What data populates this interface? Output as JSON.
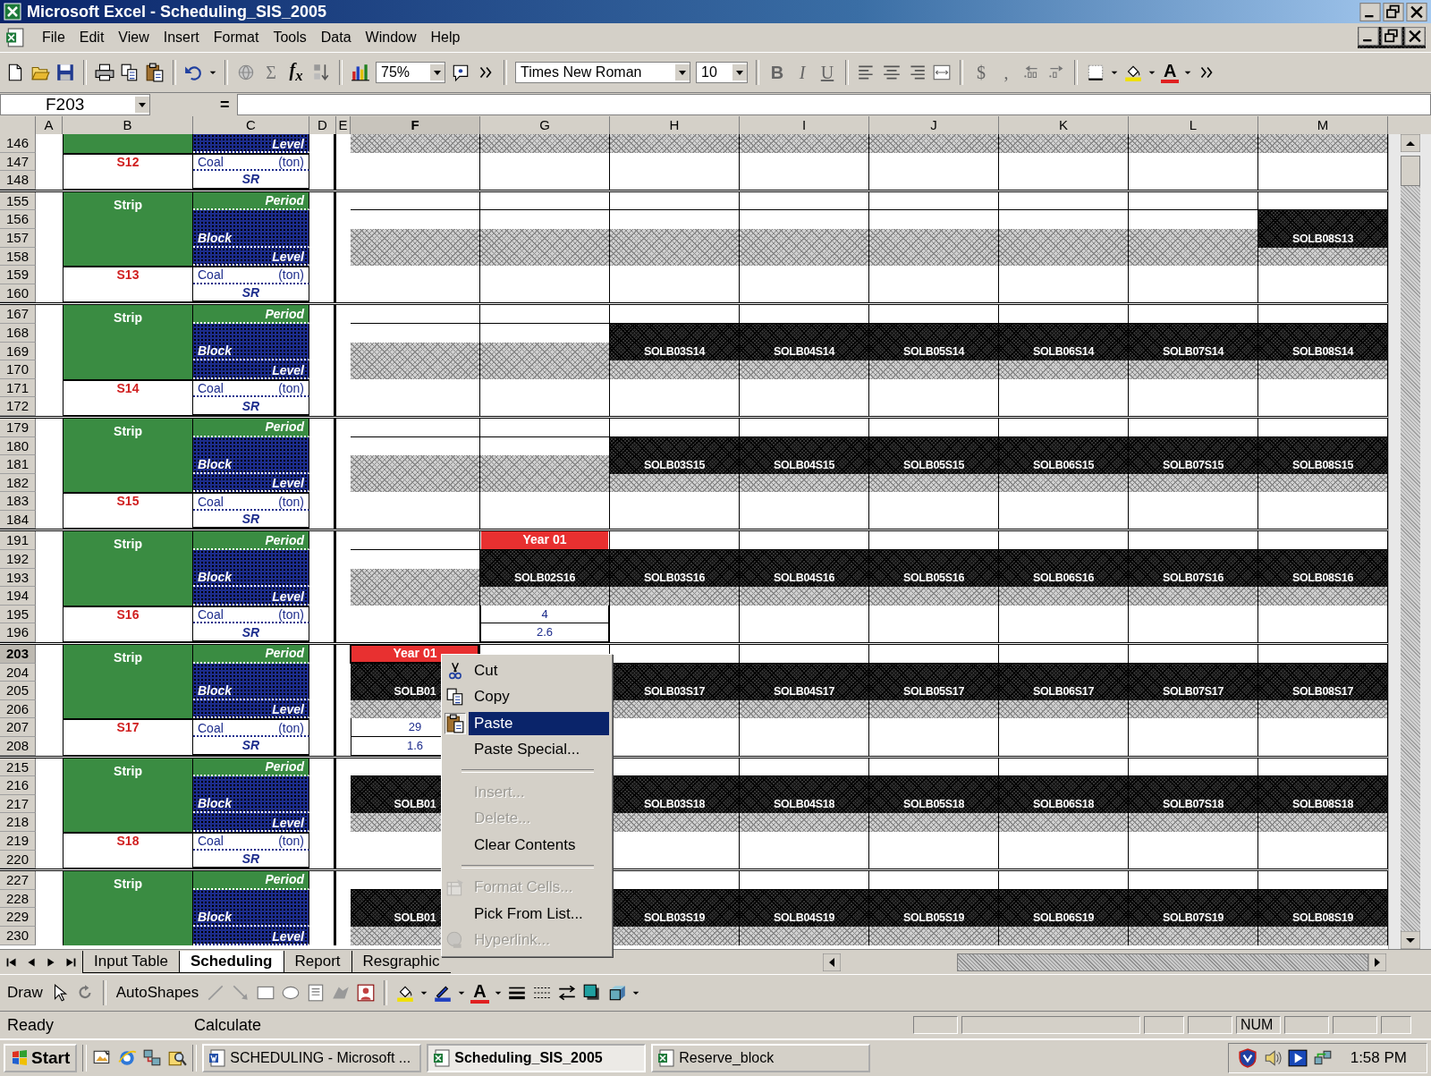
{
  "window": {
    "title": "Microsoft Excel - Scheduling_SIS_2005"
  },
  "menu": [
    "File",
    "Edit",
    "View",
    "Insert",
    "Format",
    "Tools",
    "Data",
    "Window",
    "Help"
  ],
  "toolbar": {
    "sum": "Σ",
    "function": "f$_{x}$",
    "zoom": "75%",
    "font": "Times New Roman",
    "size": "10",
    "bold": "B",
    "italic": "I",
    "underline": "U",
    "currency": "$",
    "comma": ",",
    "font_color": "A"
  },
  "formula_bar": {
    "name_box": "F203",
    "equals": "="
  },
  "columns": [
    {
      "label": "A",
      "selected": false
    },
    {
      "label": "B",
      "selected": false
    },
    {
      "label": "C",
      "selected": false
    },
    {
      "label": "D",
      "selected": false
    },
    {
      "label": "E",
      "selected": false
    },
    {
      "label": "F",
      "selected": true
    },
    {
      "label": "G",
      "selected": false
    },
    {
      "label": "H",
      "selected": false
    },
    {
      "label": "I",
      "selected": false
    },
    {
      "label": "J",
      "selected": false
    },
    {
      "label": "K",
      "selected": false
    },
    {
      "label": "L",
      "selected": false
    },
    {
      "label": "M",
      "selected": false
    }
  ],
  "groups": [
    {
      "rows": [
        {
          "n": "146",
          "selected": false
        },
        {
          "n": "147",
          "selected": false
        },
        {
          "n": "148",
          "selected": false
        }
      ],
      "level": "Level",
      "id": "S12",
      "coal": "Coal",
      "unit": "(ton)",
      "sr": "SR",
      "cells": [
        {
          "kind": "light"
        },
        {
          "kind": "light"
        },
        {
          "kind": "light"
        },
        {
          "kind": "light"
        },
        {
          "kind": "light"
        },
        {
          "kind": "light"
        },
        {
          "kind": "light"
        },
        {
          "kind": "light"
        }
      ]
    },
    {
      "rows": [
        {
          "n": "155",
          "selected": false
        },
        {
          "n": "156",
          "selected": false
        },
        {
          "n": "157",
          "selected": false
        },
        {
          "n": "158",
          "selected": false
        },
        {
          "n": "159",
          "selected": false
        },
        {
          "n": "160",
          "selected": false
        }
      ],
      "strip": "Strip",
      "period": "Period",
      "block": "Block",
      "level": "Level",
      "id": "S13",
      "coal": "Coal",
      "unit": "(ton)",
      "sr": "SR",
      "cells": [
        {
          "kind": "light",
          "selected": false
        },
        {
          "kind": "light",
          "selected": false
        },
        {
          "kind": "light",
          "selected": false
        },
        {
          "kind": "light",
          "selected": false
        },
        {
          "kind": "light",
          "selected": false
        },
        {
          "kind": "light",
          "selected": false
        },
        {
          "kind": "light",
          "selected": false
        },
        {
          "kind": "dark",
          "label": "SOLB08S13",
          "selected": false
        }
      ]
    },
    {
      "rows": [
        {
          "n": "167",
          "selected": false
        },
        {
          "n": "168",
          "selected": false
        },
        {
          "n": "169",
          "selected": false
        },
        {
          "n": "170",
          "selected": false
        },
        {
          "n": "171",
          "selected": false
        },
        {
          "n": "172",
          "selected": false
        }
      ],
      "strip": "Strip",
      "period": "Period",
      "block": "Block",
      "level": "Level",
      "id": "S14",
      "coal": "Coal",
      "unit": "(ton)",
      "sr": "SR",
      "cells": [
        {
          "kind": "light",
          "selected": false
        },
        {
          "kind": "light",
          "selected": false
        },
        {
          "kind": "dark",
          "label": "SOLB03S14",
          "selected": false
        },
        {
          "kind": "dark",
          "label": "SOLB04S14",
          "selected": false
        },
        {
          "kind": "dark",
          "label": "SOLB05S14",
          "selected": false
        },
        {
          "kind": "dark",
          "label": "SOLB06S14",
          "selected": false
        },
        {
          "kind": "dark",
          "label": "SOLB07S14",
          "selected": false
        },
        {
          "kind": "dark",
          "label": "SOLB08S14",
          "selected": false
        }
      ]
    },
    {
      "rows": [
        {
          "n": "179",
          "selected": false
        },
        {
          "n": "180",
          "selected": false
        },
        {
          "n": "181",
          "selected": false
        },
        {
          "n": "182",
          "selected": false
        },
        {
          "n": "183",
          "selected": false
        },
        {
          "n": "184",
          "selected": false
        }
      ],
      "strip": "Strip",
      "period": "Period",
      "block": "Block",
      "level": "Level",
      "id": "S15",
      "coal": "Coal",
      "unit": "(ton)",
      "sr": "SR",
      "cells": [
        {
          "kind": "light",
          "selected": false
        },
        {
          "kind": "light",
          "selected": false
        },
        {
          "kind": "dark",
          "label": "SOLB03S15",
          "selected": false
        },
        {
          "kind": "dark",
          "label": "SOLB04S15",
          "selected": false
        },
        {
          "kind": "dark",
          "label": "SOLB05S15",
          "selected": false
        },
        {
          "kind": "dark",
          "label": "SOLB06S15",
          "selected": false
        },
        {
          "kind": "dark",
          "label": "SOLB07S15",
          "selected": false
        },
        {
          "kind": "dark",
          "label": "SOLB08S15",
          "selected": false
        }
      ]
    },
    {
      "rows": [
        {
          "n": "191",
          "selected": false
        },
        {
          "n": "192",
          "selected": false
        },
        {
          "n": "193",
          "selected": false
        },
        {
          "n": "194",
          "selected": false
        },
        {
          "n": "195",
          "selected": false
        },
        {
          "n": "196",
          "selected": false
        }
      ],
      "strip": "Strip",
      "period": "Period",
      "block": "Block",
      "level": "Level",
      "id": "S16",
      "coal": "Coal",
      "unit": "(ton)",
      "sr": "SR",
      "cells": [
        {
          "kind": "light",
          "selected": false
        },
        {
          "kind": "dark",
          "label": "SOLB02S16",
          "year": "Year 01",
          "values": [
            "4",
            "2.6"
          ],
          "selected": false
        },
        {
          "kind": "dark",
          "label": "SOLB03S16",
          "selected": false
        },
        {
          "kind": "dark",
          "label": "SOLB04S16",
          "selected": false
        },
        {
          "kind": "dark",
          "label": "SOLB05S16",
          "selected": false
        },
        {
          "kind": "dark",
          "label": "SOLB06S16",
          "selected": false
        },
        {
          "kind": "dark",
          "label": "SOLB07S16",
          "selected": false
        },
        {
          "kind": "dark",
          "label": "SOLB08S16",
          "selected": false
        }
      ]
    },
    {
      "rows": [
        {
          "n": "203",
          "selected": true
        },
        {
          "n": "204",
          "selected": false
        },
        {
          "n": "205",
          "selected": false
        },
        {
          "n": "206",
          "selected": false
        },
        {
          "n": "207",
          "selected": false
        },
        {
          "n": "208",
          "selected": false
        }
      ],
      "strip": "Strip",
      "period": "Period",
      "block": "Block",
      "level": "Level",
      "id": "S17",
      "coal": "Coal",
      "unit": "(ton)",
      "sr": "SR",
      "cells": [
        {
          "kind": "dark",
          "label": "SOLB01",
          "year": "Year 01",
          "values": [
            "29",
            "1.6"
          ],
          "selected": true
        },
        {
          "kind": "blank",
          "selected": false
        },
        {
          "kind": "dark",
          "label": "SOLB03S17",
          "selected": false
        },
        {
          "kind": "dark",
          "label": "SOLB04S17",
          "selected": false
        },
        {
          "kind": "dark",
          "label": "SOLB05S17",
          "selected": false
        },
        {
          "kind": "dark",
          "label": "SOLB06S17",
          "selected": false
        },
        {
          "kind": "dark",
          "label": "SOLB07S17",
          "selected": false
        },
        {
          "kind": "dark",
          "label": "SOLB08S17",
          "selected": false
        }
      ]
    },
    {
      "rows": [
        {
          "n": "215",
          "selected": false
        },
        {
          "n": "216",
          "selected": false
        },
        {
          "n": "217",
          "selected": false
        },
        {
          "n": "218",
          "selected": false
        },
        {
          "n": "219",
          "selected": false
        },
        {
          "n": "220",
          "selected": false
        }
      ],
      "strip": "Strip",
      "period": "Period",
      "block": "Block",
      "level": "Level",
      "id": "S18",
      "coal": "Coal",
      "unit": "(ton)",
      "sr": "SR",
      "cells": [
        {
          "kind": "dark",
          "label": "SOLB01",
          "selected": false
        },
        {
          "kind": "blank"
        },
        {
          "kind": "dark",
          "label": "SOLB03S18",
          "selected": false
        },
        {
          "kind": "dark",
          "label": "SOLB04S18",
          "selected": false
        },
        {
          "kind": "dark",
          "label": "SOLB05S18",
          "selected": false
        },
        {
          "kind": "dark",
          "label": "SOLB06S18",
          "selected": false
        },
        {
          "kind": "dark",
          "label": "SOLB07S18",
          "selected": false
        },
        {
          "kind": "dark",
          "label": "SOLB08S18",
          "selected": false
        }
      ]
    },
    {
      "rows": [
        {
          "n": "227",
          "selected": false
        },
        {
          "n": "228",
          "selected": false
        },
        {
          "n": "229",
          "selected": false
        },
        {
          "n": "230",
          "selected": false
        }
      ],
      "strip": "Strip",
      "period": "Period",
      "block": "Block",
      "level": "Level",
      "cells": [
        {
          "kind": "dark",
          "label": "SOLB01",
          "selected": false
        },
        {
          "kind": "blank"
        },
        {
          "kind": "dark",
          "label": "SOLB03S19",
          "selected": false
        },
        {
          "kind": "dark",
          "label": "SOLB04S19",
          "selected": false
        },
        {
          "kind": "dark",
          "label": "SOLB05S19",
          "selected": false
        },
        {
          "kind": "dark",
          "label": "SOLB06S19",
          "selected": false
        },
        {
          "kind": "dark",
          "label": "SOLB07S19",
          "selected": false
        },
        {
          "kind": "dark",
          "label": "SOLB08S19",
          "selected": false
        }
      ]
    }
  ],
  "context_menu": [
    {
      "kind": "item",
      "label": "Cut",
      "disabled": false,
      "selected": false
    },
    {
      "kind": "item",
      "label": "Copy",
      "disabled": false,
      "selected": false
    },
    {
      "kind": "item",
      "label": "Paste",
      "disabled": false,
      "selected": true
    },
    {
      "kind": "item",
      "label": "Paste Special...",
      "disabled": false,
      "selected": false
    },
    {
      "kind": "separator"
    },
    {
      "kind": "item",
      "label": "Insert...",
      "disabled": true,
      "selected": false
    },
    {
      "kind": "item",
      "label": "Delete...",
      "disabled": true,
      "selected": false
    },
    {
      "kind": "item",
      "label": "Clear Contents",
      "disabled": false,
      "selected": false
    },
    {
      "kind": "separator"
    },
    {
      "kind": "item",
      "label": "Format Cells...",
      "disabled": true,
      "selected": false
    },
    {
      "kind": "item",
      "label": "Pick From List...",
      "disabled": false,
      "selected": false
    },
    {
      "kind": "item",
      "label": "Hyperlink...",
      "disabled": true,
      "selected": false
    }
  ],
  "sheet_tabs": [
    {
      "label": "Input Table",
      "selected": false
    },
    {
      "label": "Scheduling",
      "selected": true
    },
    {
      "label": "Report",
      "selected": false
    },
    {
      "label": "Resgraphic",
      "selected": false
    }
  ],
  "draw_toolbar": {
    "draw": "Draw",
    "autoshapes": "AutoShapes",
    "font_color": "A"
  },
  "status_bar": {
    "state": "Ready",
    "mode": "Calculate",
    "num": "NUM"
  },
  "taskbar": {
    "start": "Start",
    "tasks": [
      {
        "label": "SCHEDULING - Microsoft ...",
        "kind": "document",
        "selected": false
      },
      {
        "label": "Scheduling_SIS_2005",
        "kind": "spreadsheet",
        "selected": true
      },
      {
        "label": "Reserve_block",
        "kind": "spreadsheet",
        "selected": false
      }
    ],
    "clock": "1:58 PM"
  }
}
